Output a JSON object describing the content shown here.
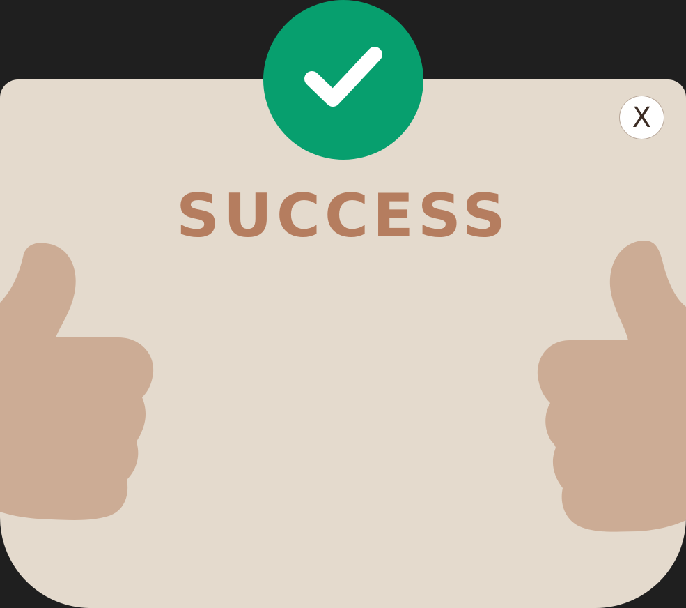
{
  "dialog": {
    "title": "SUCCESS",
    "close_label": "X"
  },
  "icons": {
    "status": "checkmark-icon",
    "decoration_left": "thumbs-up-icon",
    "decoration_right": "thumbs-up-icon"
  },
  "colors": {
    "backdrop": "#1f1f1f",
    "card": "#e4dacd",
    "badge": "#079f6e",
    "title": "#b57d5f",
    "thumb": "#ccac95"
  }
}
